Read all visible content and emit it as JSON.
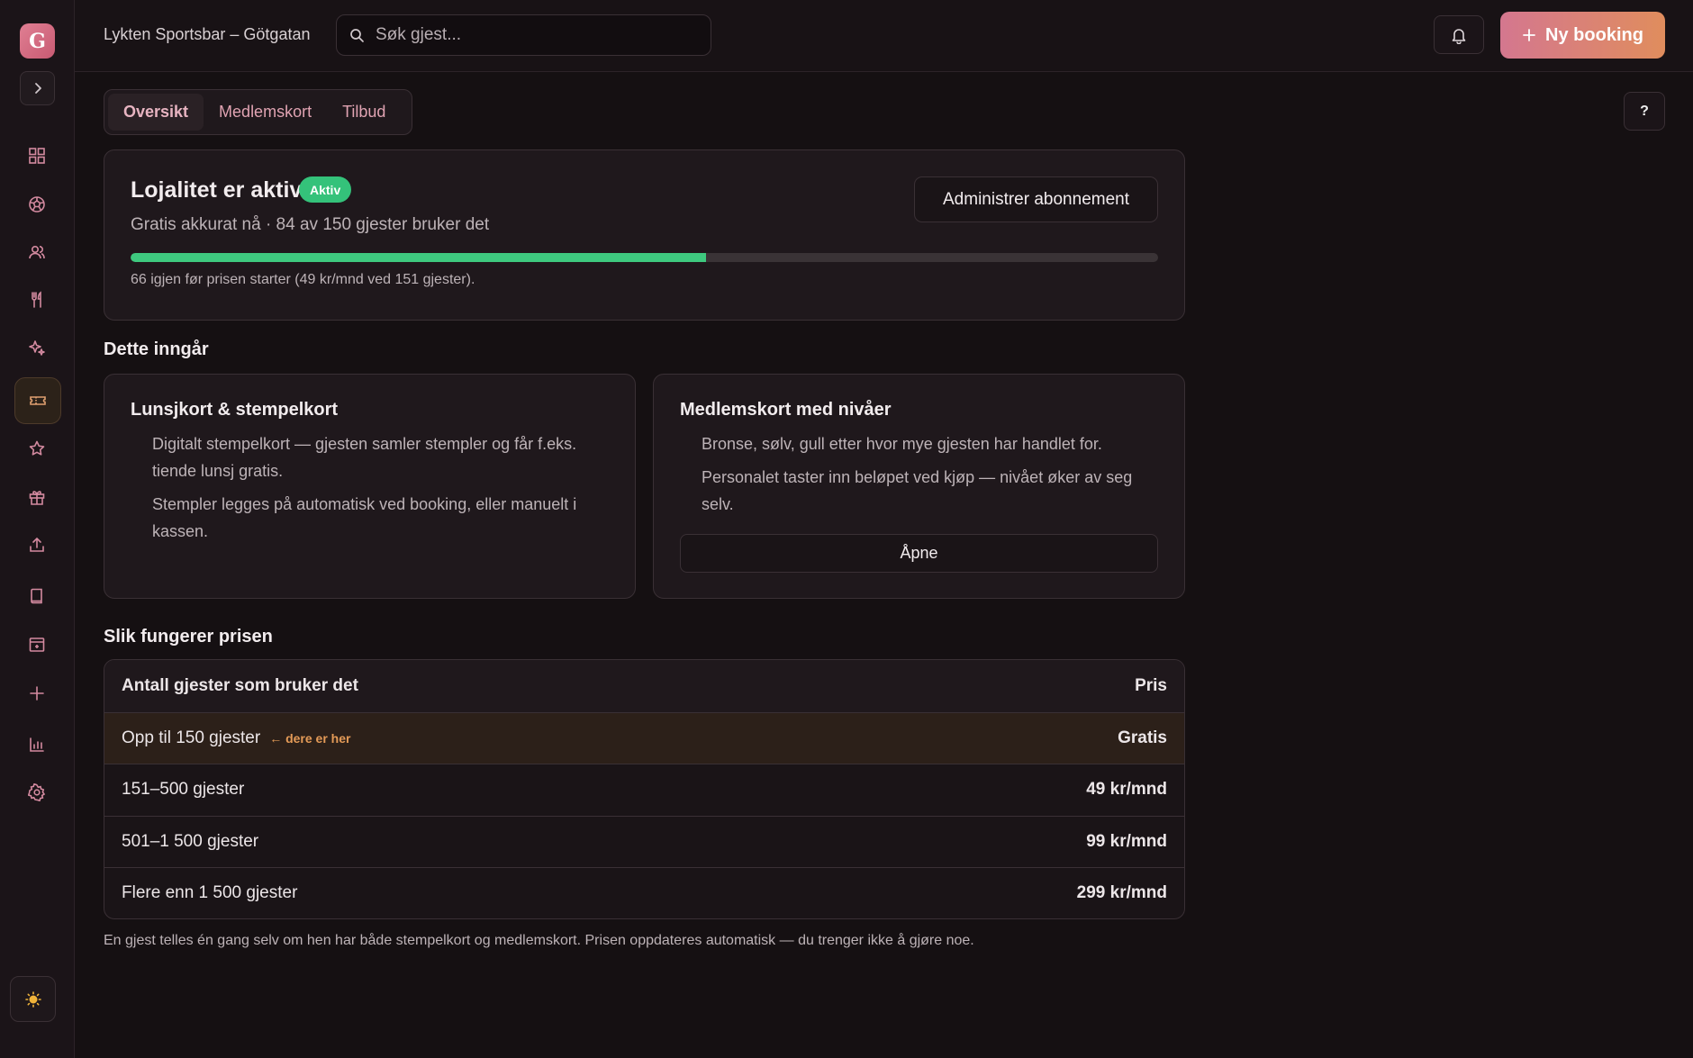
{
  "sidebar": {
    "logo_letter": "G",
    "nav": [
      {
        "icon": "dashboard-grid-icon"
      },
      {
        "icon": "sports-ball-icon"
      },
      {
        "icon": "users-icon"
      },
      {
        "icon": "cutlery-icon"
      },
      {
        "icon": "sparkles-icon"
      },
      {
        "icon": "ticket-icon",
        "active": true
      },
      {
        "icon": "star-icon"
      },
      {
        "icon": "gift-icon"
      },
      {
        "icon": "upload-icon"
      },
      {
        "icon": "book-icon"
      },
      {
        "icon": "calendar-layout-icon"
      },
      {
        "icon": "plus-icon"
      },
      {
        "icon": "bar-chart-icon"
      },
      {
        "icon": "settings-gear-icon"
      }
    ],
    "theme_icon": "sun-icon"
  },
  "header": {
    "venue": "Lykten Sportsbar – Götgatan",
    "search_placeholder": "Søk gjest...",
    "new_booking_label": "Ny booking"
  },
  "help_label": "?",
  "tabs": [
    {
      "label": "Oversikt",
      "active": true
    },
    {
      "label": "Medlemskort",
      "active": false
    },
    {
      "label": "Tilbud",
      "active": false
    }
  ],
  "loyalty": {
    "title": "Lojalitet er aktiv",
    "badge": "Aktiv",
    "subtitle": "Gratis akkurat nå · 84 av 150 gjester bruker det",
    "manage_label": "Administrer abonnement",
    "progress_fraction": 0.56,
    "note": "66 igjen før prisen starter (49 kr/mnd ved 151 gjester)."
  },
  "included": {
    "heading": "Dette inngår",
    "cards": [
      {
        "title": "Lunsjkort & stempelkort",
        "lines": [
          "Digitalt stempelkort — gjesten samler stempler og får f.eks. tiende lunsj gratis.",
          "Stempler legges på automatisk ved booking, eller manuelt i kassen."
        ]
      },
      {
        "title": "Medlemskort med nivåer",
        "lines": [
          "Bronse, sølv, gull etter hvor mye gjesten har handlet for.",
          "Personalet taster inn beløpet ved kjøp — nivået øker av seg selv."
        ],
        "button": "Åpne"
      }
    ]
  },
  "pricing": {
    "heading": "Slik fungerer prisen",
    "col_guests": "Antall gjester som bruker det",
    "col_price": "Pris",
    "here_label": "← dere er her",
    "rows": [
      {
        "guests": "Opp til 150 gjester",
        "price": "Gratis",
        "current": true
      },
      {
        "guests": "151–500 gjester",
        "price": "49 kr/mnd"
      },
      {
        "guests": "501–1 500 gjester",
        "price": "99 kr/mnd"
      },
      {
        "guests": "Flere enn 1 500 gjester",
        "price": "299 kr/mnd"
      }
    ],
    "footnote": "En gjest telles én gang selv om hen har både stempelkort og medlemskort. Prisen oppdateres automatisk — du trenger ikke å gjøre noe."
  }
}
